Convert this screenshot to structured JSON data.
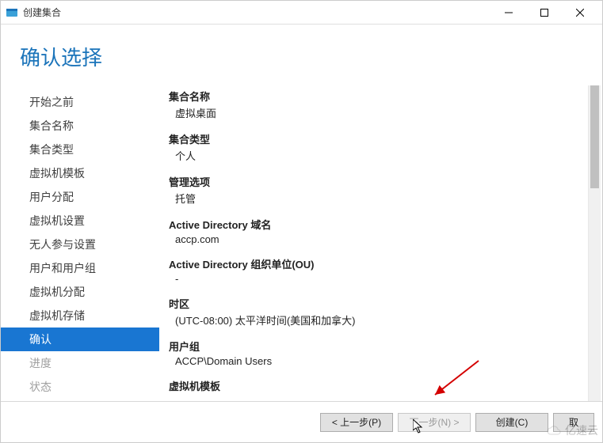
{
  "window": {
    "title": "创建集合"
  },
  "header": {
    "title": "确认选择"
  },
  "sidebar": {
    "items": [
      {
        "label": "开始之前"
      },
      {
        "label": "集合名称"
      },
      {
        "label": "集合类型"
      },
      {
        "label": "虚拟机模板"
      },
      {
        "label": "用户分配"
      },
      {
        "label": "虚拟机设置"
      },
      {
        "label": "无人参与设置"
      },
      {
        "label": "用户和用户组"
      },
      {
        "label": "虚拟机分配"
      },
      {
        "label": "虚拟机存储"
      },
      {
        "label": "确认"
      },
      {
        "label": "进度"
      },
      {
        "label": "状态"
      }
    ]
  },
  "summary": {
    "collection_name_label": "集合名称",
    "collection_name_value": "虚拟桌面",
    "collection_type_label": "集合类型",
    "collection_type_value": "个人",
    "management_options_label": "管理选项",
    "management_options_value": "托管",
    "ad_domain_label": "Active Directory 域名",
    "ad_domain_value": "accp.com",
    "ad_ou_label": "Active Directory 组织单位(OU)",
    "ad_ou_value": "-",
    "timezone_label": "时区",
    "timezone_value": "(UTC-08:00) 太平洋时间(美国和加拿大)",
    "user_group_label": "用户组",
    "user_group_value": "ACCP\\Domain Users",
    "vm_template_label": "虚拟机模板"
  },
  "footer": {
    "previous_label": "< 上一步(P)",
    "next_label": "下一步(N) >",
    "create_label": "创建(C)",
    "cancel_label": "取"
  },
  "watermark": {
    "text": "亿速云"
  }
}
